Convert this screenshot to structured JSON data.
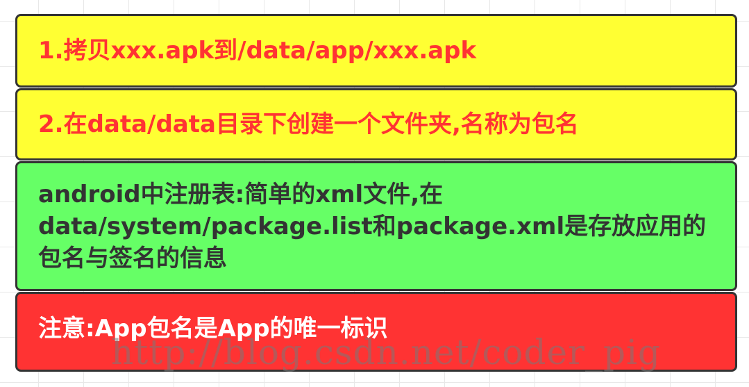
{
  "steps": [
    {
      "text": "1.拷贝xxx.apk到/data/app/xxx.apk",
      "color": "#ff3333",
      "fill": "#ffff33"
    },
    {
      "text": "2.在data/data目录下创建一个文件夹,名称为包名",
      "color": "#ff3333",
      "fill": "#ffff33"
    },
    {
      "text": "android中注册表:简单的xml文件,在data/system/package.list和package.xml是存放应用的包名与签名的信息",
      "color": "#333333",
      "fill": "#66ff66"
    },
    {
      "text": "注意:App包名是App的唯一标识",
      "color": "#ffffff",
      "fill": "#ff3333"
    }
  ],
  "watermark": "http://blog.csdn.net/coder_pig"
}
